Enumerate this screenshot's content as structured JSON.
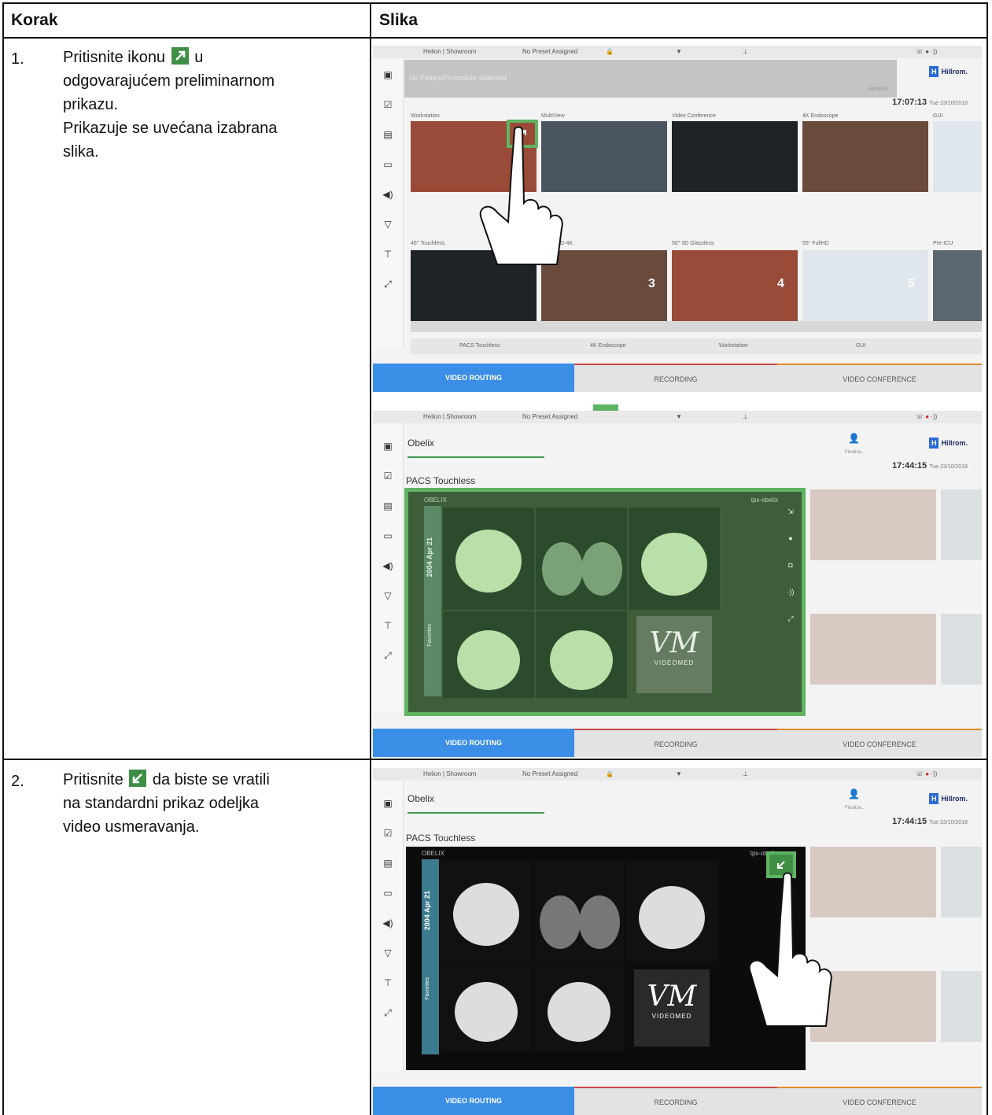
{
  "table": {
    "header_step": "Korak",
    "header_image": "Slika",
    "rows": [
      {
        "number": "1.",
        "text_before_icon": "Pritisnite ikonu",
        "text_after_icon": "u",
        "lines": [
          "odgovarajućem preliminarnom",
          "prikazu.",
          "Prikazuje se uvećana izabrana",
          "slika."
        ],
        "icon": "expand-arrow-icon"
      },
      {
        "number": "2.",
        "text_before_icon": "Pritisnite",
        "text_after_icon": "da biste se vratili",
        "lines": [
          "na standardni prikaz odeljka",
          "video usmeravanja."
        ],
        "icon": "collapse-arrow-icon"
      }
    ]
  },
  "screens": {
    "topbar": {
      "location": "Helion | Showroom",
      "preset": "No Preset Assigned"
    },
    "screen1": {
      "patient": "No Patient/Procedure Selected",
      "finalize": "Finalize...",
      "time": "17:07:13",
      "date": "Tue 23/10/2018",
      "sources": [
        "Workstation",
        "MultiView",
        "Video Conference",
        "4K Endoscope",
        "GUI"
      ],
      "monitors": [
        "46\" Touchless",
        "UHD-4K",
        "50\" 3D Glassless",
        "55\" FullHD",
        "Pre-ICU"
      ],
      "monitor_numbers": [
        "3",
        "4",
        "5"
      ],
      "thumb_labels": [
        "PACS Touchless",
        "4K Endoscope",
        "Workstation",
        "GUI"
      ]
    },
    "screen2": {
      "patient": "Obelix",
      "finalize": "Finalize...",
      "time": "17:44:15",
      "date": "Tue 23/10/2018",
      "title": "PACS Touchless",
      "viewer_name": "OBELIX",
      "viewer_user": "tpx-obelix",
      "date_vertical": "2004 Apr 21",
      "favorites": "Favorites"
    },
    "screen3": {
      "patient": "Obelix",
      "finalize": "Finalize...",
      "time": "17:44:15",
      "date": "Tue 23/10/2018",
      "title": "PACS Touchless",
      "viewer_name": "OBELIX",
      "viewer_user": "tpx-obeli"
    },
    "logo_text": "VIDEOMED",
    "logo_mark": "VM",
    "brand": "Hillrom.",
    "brand_badge": "H",
    "tabs": {
      "video_routing": "VIDEO ROUTING",
      "recording": "RECORDING",
      "video_conference": "VIDEO CONFERENCE"
    }
  }
}
